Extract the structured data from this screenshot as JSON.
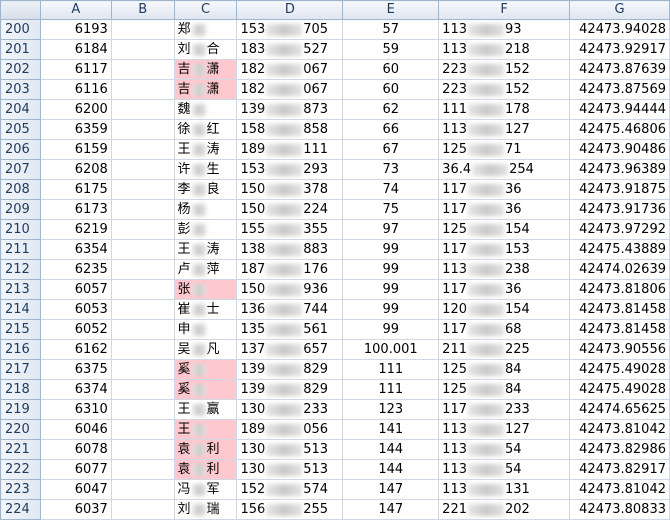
{
  "columns": [
    "A",
    "B",
    "C",
    "D",
    "E",
    "F",
    "G"
  ],
  "rows": [
    {
      "n": "200",
      "a": "6193",
      "c1": "郑",
      "c2": "",
      "d1": "153",
      "d2": "705",
      "e": "57",
      "f1": "113",
      "f2": "93",
      "g": "42473.94028",
      "hl": false
    },
    {
      "n": "201",
      "a": "6184",
      "c1": "刘",
      "c2": "合",
      "d1": "183",
      "d2": "527",
      "e": "59",
      "f1": "113",
      "f2": "218",
      "g": "42473.92917",
      "hl": false
    },
    {
      "n": "202",
      "a": "6117",
      "c1": "吉",
      "c2": "潇",
      "d1": "182",
      "d2": "067",
      "e": "60",
      "f1": "223",
      "f2": "152",
      "g": "42473.87639",
      "hl": true
    },
    {
      "n": "203",
      "a": "6116",
      "c1": "吉",
      "c2": "潇",
      "d1": "182",
      "d2": "067",
      "e": "60",
      "f1": "223",
      "f2": "152",
      "g": "42473.87569",
      "hl": true
    },
    {
      "n": "204",
      "a": "6200",
      "c1": "魏",
      "c2": "",
      "d1": "139",
      "d2": "873",
      "e": "62",
      "f1": "111",
      "f2": "178",
      "g": "42473.94444",
      "hl": false
    },
    {
      "n": "205",
      "a": "6359",
      "c1": "徐",
      "c2": "红",
      "d1": "158",
      "d2": "858",
      "e": "66",
      "f1": "113",
      "f2": "127",
      "g": "42475.46806",
      "hl": false
    },
    {
      "n": "206",
      "a": "6159",
      "c1": "王",
      "c2": "涛",
      "d1": "189",
      "d2": "111",
      "e": "67",
      "f1": "125",
      "f2": "71",
      "g": "42473.90486",
      "hl": false
    },
    {
      "n": "207",
      "a": "6208",
      "c1": "许",
      "c2": "生",
      "d1": "153",
      "d2": "293",
      "e": "73",
      "f1": "36.4",
      "f2": "254",
      "g": "42473.96389",
      "hl": false
    },
    {
      "n": "208",
      "a": "6175",
      "c1": "李",
      "c2": "良",
      "d1": "150",
      "d2": "378",
      "e": "74",
      "f1": "117",
      "f2": "36",
      "g": "42473.91875",
      "hl": false
    },
    {
      "n": "209",
      "a": "6173",
      "c1": "杨",
      "c2": "",
      "d1": "150",
      "d2": "224",
      "e": "75",
      "f1": "117",
      "f2": "36",
      "g": "42473.91736",
      "hl": false
    },
    {
      "n": "210",
      "a": "6219",
      "c1": "彭",
      "c2": "",
      "d1": "155",
      "d2": "355",
      "e": "97",
      "f1": "125",
      "f2": "154",
      "g": "42473.97292",
      "hl": false
    },
    {
      "n": "211",
      "a": "6354",
      "c1": "王",
      "c2": "涛",
      "d1": "138",
      "d2": "883",
      "e": "99",
      "f1": "117",
      "f2": "153",
      "g": "42475.43889",
      "hl": false
    },
    {
      "n": "212",
      "a": "6235",
      "c1": "卢",
      "c2": "萍",
      "d1": "187",
      "d2": "176",
      "e": "99",
      "f1": "113",
      "f2": "238",
      "g": "42474.02639",
      "hl": false
    },
    {
      "n": "213",
      "a": "6057",
      "c1": "张",
      "c2": "",
      "d1": "150",
      "d2": "936",
      "e": "99",
      "f1": "117",
      "f2": "36",
      "g": "42473.81806",
      "hl": true
    },
    {
      "n": "214",
      "a": "6053",
      "c1": "崔",
      "c2": "士",
      "d1": "136",
      "d2": "744",
      "e": "99",
      "f1": "120",
      "f2": "154",
      "g": "42473.81458",
      "hl": false
    },
    {
      "n": "215",
      "a": "6052",
      "c1": "申",
      "c2": "",
      "d1": "135",
      "d2": "561",
      "e": "99",
      "f1": "117",
      "f2": "68",
      "g": "42473.81458",
      "hl": false
    },
    {
      "n": "216",
      "a": "6162",
      "c1": "吴",
      "c2": "凡",
      "d1": "137",
      "d2": "657",
      "e": "100.001",
      "f1": "211",
      "f2": "225",
      "g": "42473.90556",
      "hl": false
    },
    {
      "n": "217",
      "a": "6375",
      "c1": "奚",
      "c2": "",
      "d1": "139",
      "d2": "829",
      "e": "111",
      "f1": "125",
      "f2": "84",
      "g": "42475.49028",
      "hl": true
    },
    {
      "n": "218",
      "a": "6374",
      "c1": "奚",
      "c2": "",
      "d1": "139",
      "d2": "829",
      "e": "111",
      "f1": "125",
      "f2": "84",
      "g": "42475.49028",
      "hl": true
    },
    {
      "n": "219",
      "a": "6310",
      "c1": "王",
      "c2": "赢",
      "d1": "130",
      "d2": "233",
      "e": "123",
      "f1": "117",
      "f2": "233",
      "g": "42474.65625",
      "hl": false
    },
    {
      "n": "220",
      "a": "6046",
      "c1": "王",
      "c2": "",
      "d1": "189",
      "d2": "056",
      "e": "141",
      "f1": "113",
      "f2": "127",
      "g": "42473.81042",
      "hl": true
    },
    {
      "n": "221",
      "a": "6078",
      "c1": "袁",
      "c2": "利",
      "d1": "130",
      "d2": "513",
      "e": "144",
      "f1": "113",
      "f2": "54",
      "g": "42473.82986",
      "hl": true
    },
    {
      "n": "222",
      "a": "6077",
      "c1": "袁",
      "c2": "利",
      "d1": "130",
      "d2": "513",
      "e": "144",
      "f1": "113",
      "f2": "54",
      "g": "42473.82917",
      "hl": true
    },
    {
      "n": "223",
      "a": "6047",
      "c1": "冯",
      "c2": "军",
      "d1": "152",
      "d2": "574",
      "e": "147",
      "f1": "113",
      "f2": "131",
      "g": "42473.81042",
      "hl": false
    },
    {
      "n": "224",
      "a": "6037",
      "c1": "刘",
      "c2": "瑞",
      "d1": "156",
      "d2": "255",
      "e": "147",
      "f1": "221",
      "f2": "202",
      "g": "42473.80833",
      "hl": false
    }
  ]
}
